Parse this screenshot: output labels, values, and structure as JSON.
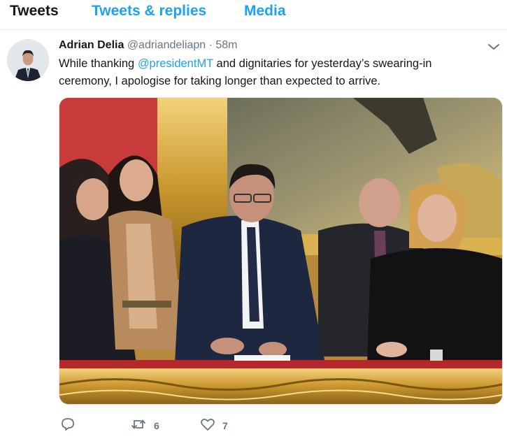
{
  "tabs": [
    {
      "label": "Tweets"
    },
    {
      "label": "Tweets & replies"
    },
    {
      "label": "Media"
    }
  ],
  "tweet": {
    "author_name": "Adrian Delia",
    "handle": "@adriandeliapn",
    "separator": "·",
    "time": "58m",
    "text_before": "While thanking ",
    "mention": "@presidentMT",
    "text_after": " and dignitaries for yesterday’s swearing-in ceremony, I apologise for taking longer than expected to arrive.",
    "icons": {
      "caret": "chevron-down-icon",
      "reply": "reply-icon",
      "retweet": "retweet-icon",
      "like": "heart-icon"
    },
    "retweet_count": "6",
    "like_count": "7"
  },
  "colors": {
    "accent": "#1da1f2",
    "secondary_text": "#657786",
    "divider": "#e6ecf0"
  }
}
